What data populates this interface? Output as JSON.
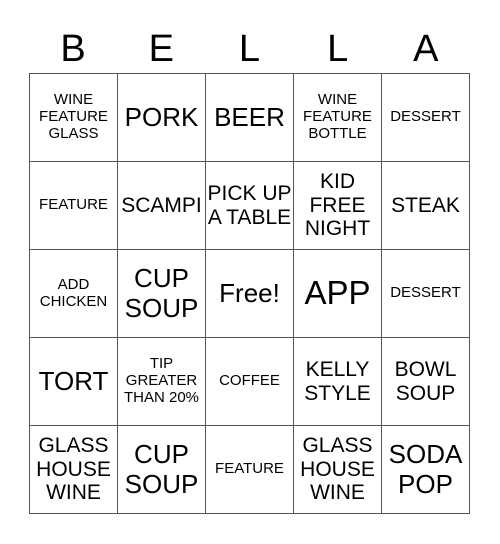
{
  "card": {
    "header": [
      "B",
      "E",
      "L",
      "L",
      "A"
    ],
    "rows": [
      [
        {
          "text": "WINE FEATURE GLASS",
          "size": "s15"
        },
        {
          "text": "PORK",
          "size": "s26"
        },
        {
          "text": "BEER",
          "size": "s26"
        },
        {
          "text": "WINE FEATURE BOTTLE",
          "size": "s15"
        },
        {
          "text": "DESSERT",
          "size": "s15"
        }
      ],
      [
        {
          "text": "FEATURE",
          "size": "s15"
        },
        {
          "text": "SCAMPI",
          "size": "s20"
        },
        {
          "text": "PICK UP A TABLE",
          "size": "s20"
        },
        {
          "text": "KID FREE NIGHT",
          "size": "s20"
        },
        {
          "text": "STEAK",
          "size": "s20"
        }
      ],
      [
        {
          "text": "ADD CHICKEN",
          "size": "s15"
        },
        {
          "text": "CUP SOUP",
          "size": "s26"
        },
        {
          "text": "Free!",
          "size": "s26"
        },
        {
          "text": "APP",
          "size": "s32"
        },
        {
          "text": "DESSERT",
          "size": "s15"
        }
      ],
      [
        {
          "text": "TORT",
          "size": "s26"
        },
        {
          "text": "TIP GREATER THAN 20%",
          "size": "s15"
        },
        {
          "text": "COFFEE",
          "size": "s15"
        },
        {
          "text": "KELLY STYLE",
          "size": "s20"
        },
        {
          "text": "BOWL SOUP",
          "size": "s20"
        }
      ],
      [
        {
          "text": "GLASS HOUSE WINE",
          "size": "s20"
        },
        {
          "text": "CUP SOUP",
          "size": "s26"
        },
        {
          "text": "FEATURE",
          "size": "s15"
        },
        {
          "text": "GLASS HOUSE WINE",
          "size": "s20"
        },
        {
          "text": "SODA POP",
          "size": "s26"
        }
      ]
    ]
  }
}
